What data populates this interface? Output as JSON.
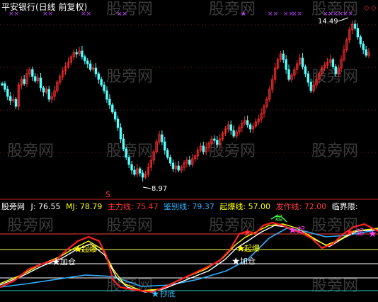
{
  "upper_panel": {
    "title": "平安银行(日线 前复权)",
    "high_label": "14.49",
    "low_label": "8.97",
    "s_marker": "S"
  },
  "indicator_bar": {
    "panel_name": "股旁网",
    "items": [
      {
        "label": "J:",
        "value": "76.55",
        "color": "#ffffff"
      },
      {
        "label": "MJ:",
        "value": "78.79",
        "color": "#ffff00"
      },
      {
        "label": "主力线:",
        "value": "75.47",
        "color": "#ff3030"
      },
      {
        "label": "鉴别线:",
        "value": "79.37",
        "color": "#30b0ff"
      },
      {
        "label": "起爆线:",
        "value": "57.00",
        "color": "#ffff00"
      },
      {
        "label": "发作线:",
        "value": "72.00",
        "color": "#ff4040"
      },
      {
        "label": "临界限:",
        "value": "",
        "color": "#ffffff"
      }
    ]
  },
  "lower_panel": {
    "signals": {
      "qibao_1": "起爆",
      "jiacang_1": "加仓",
      "chaodi": "抄底",
      "qibao_2": "起爆",
      "jiacang_2": "加仓",
      "qi_top": "起",
      "fuqi_1": "起",
      "fuqi_2": "起"
    }
  },
  "watermarks": [
    "股旁网",
    "股旁网",
    "股旁网",
    "股旁网",
    "股旁网",
    "股旁网",
    "股旁网",
    "股旁网",
    "股旁网",
    "股旁网",
    "股旁网",
    "股旁网",
    "股旁网",
    "股旁网",
    "股旁网"
  ],
  "colors": {
    "up_candle": "#ff3030",
    "down_candle": "#54ffff",
    "grid_dot": "#a03030",
    "mj_line": "#ffff00",
    "j_line": "#ffffff",
    "main_line": "#ff2020",
    "judge_line": "#30b0ff"
  }
}
